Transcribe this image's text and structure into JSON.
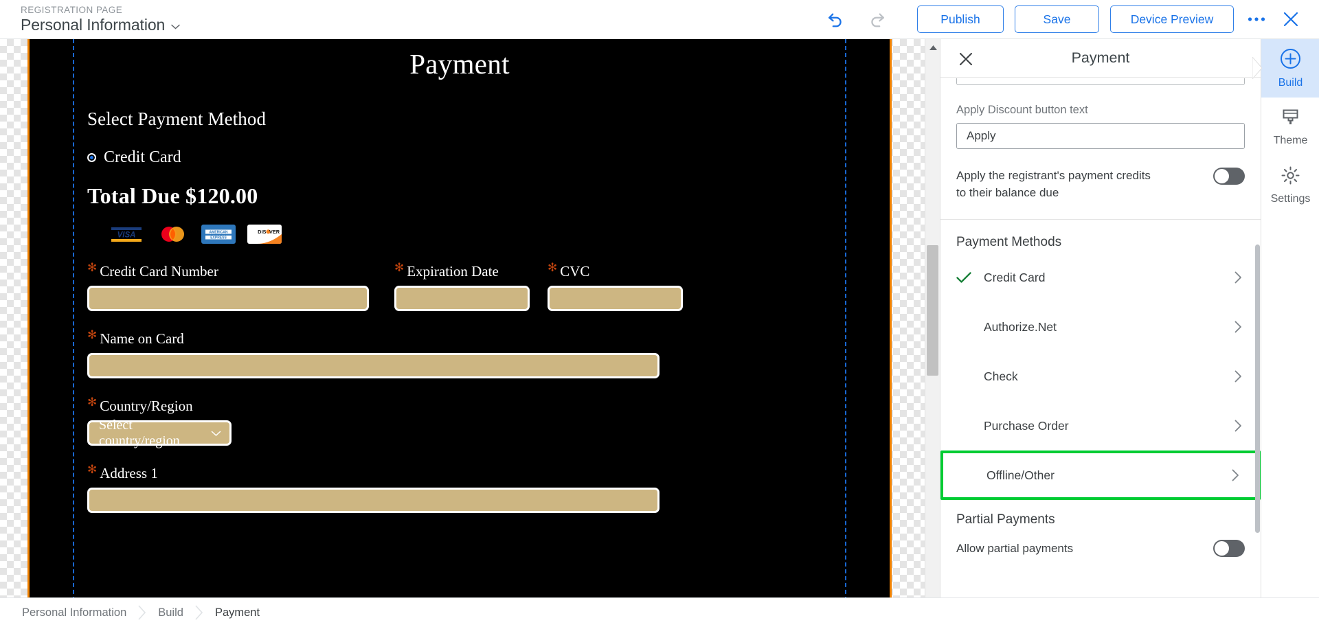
{
  "topbar": {
    "kicker": "REGISTRATION PAGE",
    "page_title": "Personal Information",
    "undo_icon": "undo-icon",
    "redo_icon": "redo-icon",
    "publish_label": "Publish",
    "save_label": "Save",
    "device_preview_label": "Device Preview",
    "more_icon": "more-options-icon",
    "close_icon": "close-icon",
    "accent_color": "#1a73e8"
  },
  "canvas": {
    "heading": "Payment",
    "select_method_label": "Select Payment Method",
    "radio_label": "Credit Card",
    "radio_selected": true,
    "total_due": "Total Due $120.00",
    "card_logos": [
      "visa-logo",
      "mastercard-logo",
      "amex-logo",
      "discover-logo"
    ],
    "page_background": "#000000",
    "field_fill": "#cdb682",
    "selection_border": "#f18100",
    "guide_color": "#1967d2",
    "fields": [
      {
        "label": "Credit Card Number",
        "required": true,
        "value": "",
        "type": "text"
      },
      {
        "label": "Expiration Date",
        "required": true,
        "value": "",
        "type": "text"
      },
      {
        "label": "CVC",
        "required": true,
        "value": "",
        "type": "text"
      },
      {
        "label": "Name on Card",
        "required": true,
        "value": "",
        "type": "text"
      },
      {
        "label": "Country/Region",
        "required": true,
        "value": "Select country/region",
        "type": "select"
      },
      {
        "label": "Address 1",
        "required": true,
        "value": "",
        "type": "text"
      }
    ]
  },
  "props": {
    "title": "Payment",
    "close_icon": "close-icon",
    "apply_discount_label": "Apply Discount button text",
    "apply_discount_value": "Apply",
    "credits_toggle_label": "Apply the registrant's payment credits to their balance due",
    "credits_toggle_on": false,
    "payment_methods_title": "Payment Methods",
    "payment_methods": [
      {
        "name": "Credit Card",
        "enabled": true,
        "highlighted": false
      },
      {
        "name": "Authorize.Net",
        "enabled": false,
        "highlighted": false
      },
      {
        "name": "Check",
        "enabled": false,
        "highlighted": false
      },
      {
        "name": "Purchase Order",
        "enabled": false,
        "highlighted": false
      },
      {
        "name": "Offline/Other",
        "enabled": false,
        "highlighted": true
      }
    ],
    "partial_payments_title": "Partial Payments",
    "allow_partial_label": "Allow partial payments",
    "allow_partial_on": false,
    "highlight_color": "#00cc33",
    "check_color": "#188038"
  },
  "rail": {
    "items": [
      {
        "label": "Build",
        "icon": "plus-circle-icon",
        "active": true
      },
      {
        "label": "Theme",
        "icon": "paint-brush-icon",
        "active": false
      },
      {
        "label": "Settings",
        "icon": "gear-icon",
        "active": false
      }
    ]
  },
  "breadcrumb": {
    "items": [
      {
        "label": "Personal Information",
        "current": false
      },
      {
        "label": "Build",
        "current": false
      },
      {
        "label": "Payment",
        "current": true
      }
    ]
  }
}
